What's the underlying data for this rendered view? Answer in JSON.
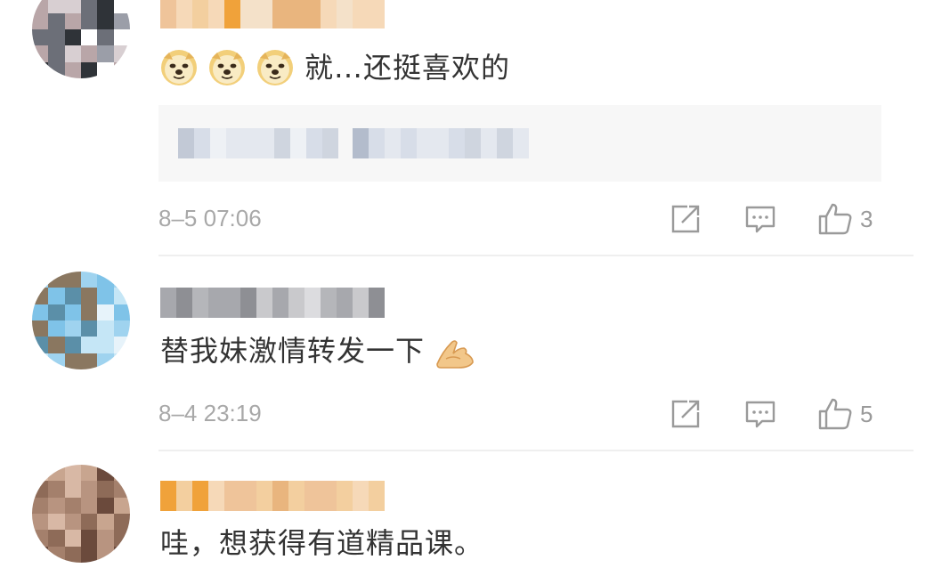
{
  "comments": [
    {
      "text": "就…还挺喜欢的",
      "leading_emoji": [
        "doge",
        "doge",
        "doge"
      ],
      "has_quote": true,
      "timestamp": "8–5 07:06",
      "likes": "3",
      "avatar_palette": [
        "#2f3338",
        "#6c6f78",
        "#b9a6a8",
        "#d8cfd2",
        "#9b9ea8",
        "#ffffff"
      ],
      "name_palette": [
        "#f6d9b8",
        "#efc49a",
        "#f4e1c9",
        "#e9b57e",
        "#f3cf9f",
        "#f0a23a"
      ]
    },
    {
      "text": "替我妹激情转发一下",
      "trailing_emoji": "pray",
      "has_quote": false,
      "timestamp": "8–4 23:19",
      "likes": "5",
      "avatar_palette": [
        "#9fd3ef",
        "#7fc3e8",
        "#c5e6f6",
        "#5b8fa8",
        "#8a7760",
        "#e7f3fa"
      ],
      "name_palette": [
        "#c9c9cc",
        "#b5b6ba",
        "#dcdcdf",
        "#a7a8ad",
        "#e6e6e8",
        "#8e8f94"
      ]
    },
    {
      "text": "哇，想获得有道精品课。",
      "has_quote": false,
      "avatar_palette": [
        "#b89480",
        "#8e6b58",
        "#d8b8a5",
        "#6b4a3c",
        "#c8a58f",
        "#a4806c"
      ],
      "name_palette": [
        "#f6d9b8",
        "#efc49a",
        "#f4e1c9",
        "#e9b57e",
        "#f3cf9f",
        "#f0a23a"
      ]
    }
  ],
  "quote_palette": [
    "#d7dde8",
    "#c2c9d6",
    "#e4e8ef",
    "#b3bccc",
    "#cfd5df",
    "#eef1f5"
  ],
  "icons": {
    "share": "share-icon",
    "comment": "comment-icon",
    "like": "thumbs-up-icon"
  }
}
